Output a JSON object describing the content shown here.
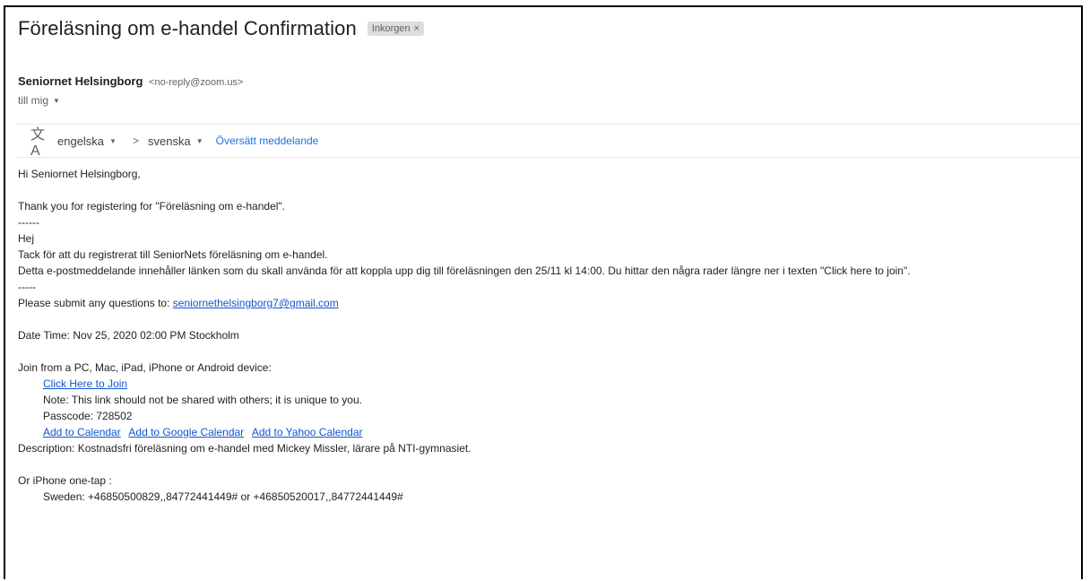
{
  "email": {
    "subject": "Föreläsning om e-handel Confirmation",
    "label": "Inkorgen",
    "label_close": "×",
    "sender_name": "Seniornet Helsingborg",
    "sender_email": "<no-reply@zoom.us>",
    "to_text": "till mig",
    "to_caret": "▼"
  },
  "translate": {
    "icon": "translate-icon",
    "icon_glyph": "文A",
    "from_lang": "engelska",
    "to_lang": "svenska",
    "caret": "▼",
    "arrow": ">",
    "action": "Översätt meddelande"
  },
  "body": {
    "greeting": "Hi Seniornet Helsingborg,",
    "thanks": "Thank you for registering for \"Föreläsning om e-handel\".",
    "sep1": "------",
    "hej": "Hej",
    "tack": "Tack för att du registrerat till SeniorNets föreläsning om e-handel.",
    "detta": "Detta e-postmeddelande innehåller länken som du skall använda för att koppla upp dig till föreläsningen den 25/11 kl 14:00. Du hittar den några rader längre ner i texten \"Click here to join\".",
    "sep2": "-----",
    "questions_prefix": "Please submit any questions to: ",
    "questions_email": "seniornethelsingborg7@gmail.com",
    "date_time": "Date Time: Nov 25, 2020 02:00 PM Stockholm",
    "join_from": "Join from a PC, Mac, iPad, iPhone or Android device:",
    "click_join": "Click Here to Join",
    "note": "Note: This link should not be shared with others; it is unique to you.",
    "passcode": "Passcode: 728502",
    "add_calendar": "Add to Calendar",
    "add_google": "Add to Google Calendar",
    "add_yahoo": "Add to Yahoo Calendar",
    "description": "Description: Kostnadsfri föreläsning om e-handel med Mickey Missler, lärare på NTI-gymnasiet.",
    "iphone_tap": "Or iPhone one-tap :",
    "sweden": "Sweden: +46850500829,,84772441449# or +46850520017,,84772441449#"
  }
}
